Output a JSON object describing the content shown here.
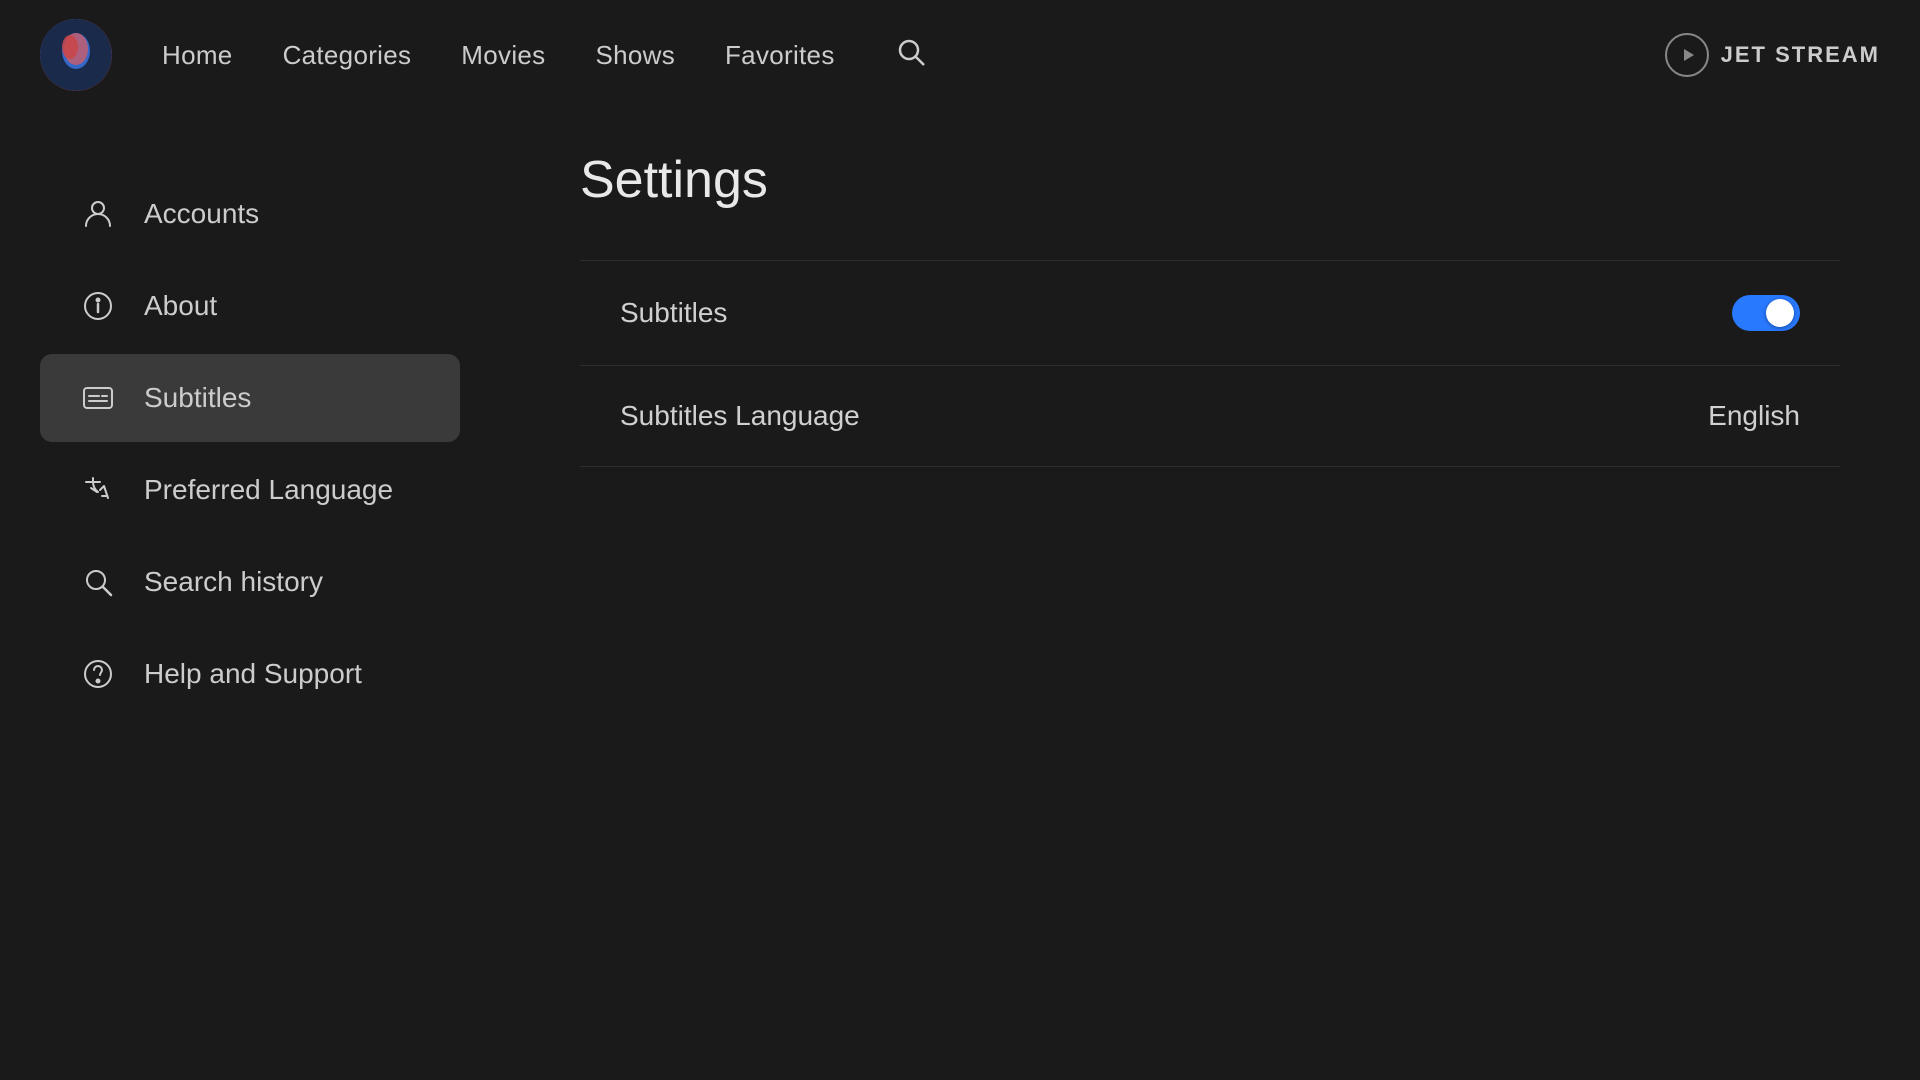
{
  "brand": {
    "name": "JET STREAM"
  },
  "nav": {
    "links": [
      {
        "id": "home",
        "label": "Home"
      },
      {
        "id": "categories",
        "label": "Categories"
      },
      {
        "id": "movies",
        "label": "Movies"
      },
      {
        "id": "shows",
        "label": "Shows"
      },
      {
        "id": "favorites",
        "label": "Favorites"
      }
    ]
  },
  "sidebar": {
    "items": [
      {
        "id": "accounts",
        "label": "Accounts",
        "icon": "person"
      },
      {
        "id": "about",
        "label": "About",
        "icon": "info"
      },
      {
        "id": "subtitles",
        "label": "Subtitles",
        "icon": "subtitles",
        "active": true
      },
      {
        "id": "preferred-language",
        "label": "Preferred Language",
        "icon": "translate"
      },
      {
        "id": "search-history",
        "label": "Search history",
        "icon": "search"
      },
      {
        "id": "help-support",
        "label": "Help and Support",
        "icon": "help"
      }
    ]
  },
  "settings": {
    "title": "Settings",
    "rows": [
      {
        "id": "subtitles-toggle",
        "label": "Subtitles",
        "type": "toggle",
        "value": true
      },
      {
        "id": "subtitles-language",
        "label": "Subtitles Language",
        "type": "value",
        "value": "English"
      }
    ]
  },
  "colors": {
    "accent": "#2979ff",
    "background": "#1a1a1a",
    "sidebar_active": "#3a3a3a"
  }
}
